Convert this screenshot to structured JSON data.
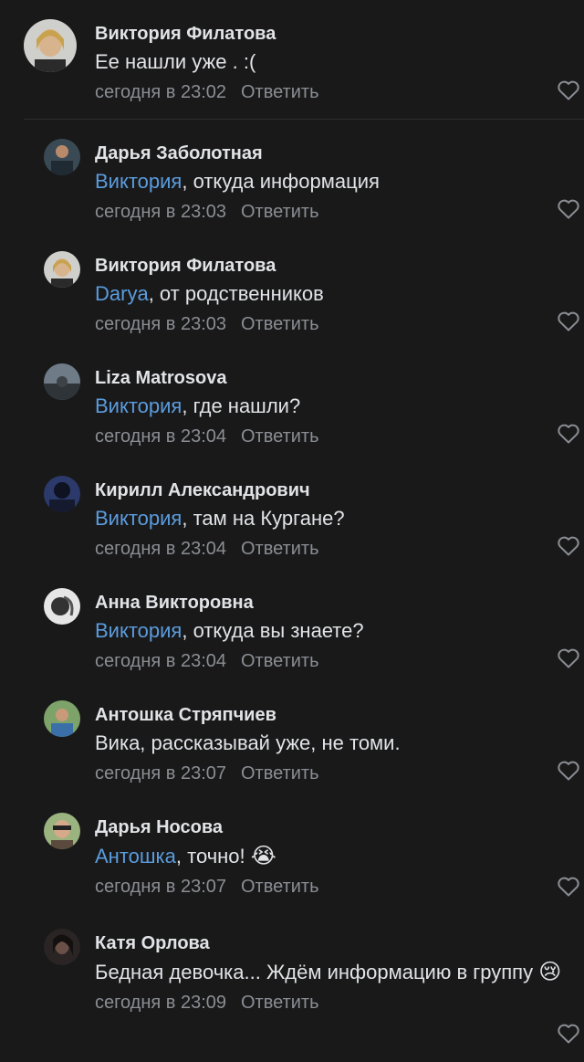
{
  "comments": [
    {
      "author": "Виктория Филатова",
      "mention": "",
      "text": "Ее нашли уже . :(",
      "time": "сегодня в 23:02",
      "reply": "Ответить",
      "emoji": ""
    },
    {
      "author": "Дарья Заболотная",
      "mention": "Виктория",
      "text": ", откуда информация",
      "time": "сегодня в 23:03",
      "reply": "Ответить",
      "emoji": ""
    },
    {
      "author": "Виктория Филатова",
      "mention": "Darya",
      "text": ", от родственников",
      "time": "сегодня в 23:03",
      "reply": "Ответить",
      "emoji": ""
    },
    {
      "author": "Liza Matrosova",
      "mention": "Виктория",
      "text": ", где нашли?",
      "time": "сегодня в 23:04",
      "reply": "Ответить",
      "emoji": ""
    },
    {
      "author": "Кирилл Александрович",
      "mention": "Виктория",
      "text": ", там на Кургане?",
      "time": "сегодня в 23:04",
      "reply": "Ответить",
      "emoji": ""
    },
    {
      "author": "Анна Викторовна",
      "mention": "Виктория",
      "text": ", откуда вы знаете?",
      "time": "сегодня в 23:04",
      "reply": "Ответить",
      "emoji": ""
    },
    {
      "author": "Антошка Стряпчиев",
      "mention": "",
      "text": "Вика, рассказывай уже, не томи.",
      "time": "сегодня в 23:07",
      "reply": "Ответить",
      "emoji": ""
    },
    {
      "author": "Дарья Носова",
      "mention": "Антошка",
      "text": ", точно! ",
      "time": "сегодня в 23:07",
      "reply": "Ответить",
      "emoji": "😭"
    },
    {
      "author": "Катя Орлова",
      "mention": "",
      "text": "Бедная девочка... Ждём информацию в группу",
      "time": "сегодня в 23:09",
      "reply": "Ответить",
      "emoji": "😢"
    }
  ],
  "icons": {
    "like": "heart-outline-icon"
  },
  "colors": {
    "background": "#19191a",
    "mention": "#5b9cdd",
    "secondary": "#8a8e93",
    "text": "#e1e3e6"
  }
}
